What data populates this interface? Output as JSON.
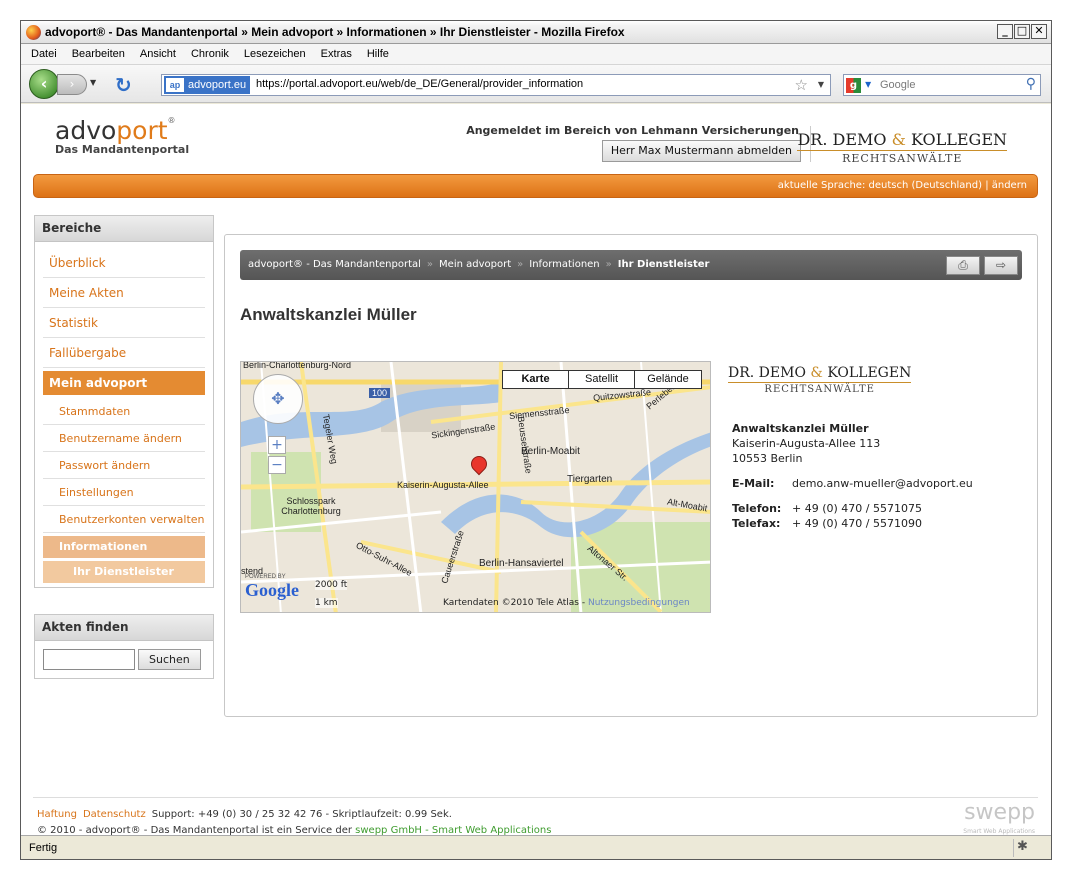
{
  "browser": {
    "title": "advoport® - Das Mandantenportal » Mein advoport » Informationen » Ihr Dienstleister - Mozilla Firefox",
    "menu": [
      "Datei",
      "Bearbeiten",
      "Ansicht",
      "Chronik",
      "Lesezeichen",
      "Extras",
      "Hilfe"
    ],
    "identity": "advoport.eu",
    "identity_badge": "ap",
    "url": "https://portal.advoport.eu/web/de_DE/General/provider_information",
    "search_placeholder": "Google",
    "status": "Fertig"
  },
  "header": {
    "logo_word_a": "advo",
    "logo_word_b": "port",
    "logo_sub": "Das Mandantenportal",
    "login_info": "Angemeldet im Bereich von Lehmann Versicherungen",
    "logout_label": "Herr Max Mustermann abmelden",
    "firm_name_a": "DR. DEMO",
    "firm_amp": "&",
    "firm_name_b": "KOLLEGEN",
    "firm_sub": "RECHTSANWÄLTE",
    "language": "aktuelle Sprache: deutsch (Deutschland) | ändern"
  },
  "sidebar": {
    "heading": "Bereiche",
    "items": [
      "Überblick",
      "Meine Akten",
      "Statistik",
      "Fallübergabe"
    ],
    "active": "Mein advoport",
    "sub_items": [
      "Stammdaten",
      "Benutzername ändern",
      "Passwort ändern",
      "Einstellungen",
      "Benutzerkonten verwalten"
    ],
    "info_item": "Informationen",
    "current_item": "Ihr Dienstleister",
    "search_heading": "Akten finden",
    "search_button": "Suchen"
  },
  "breadcrumb": {
    "items": [
      "advoport® - Das Mandantenportal",
      "Mein advoport",
      "Informationen"
    ],
    "current": "Ihr Dienstleister"
  },
  "main": {
    "title": "Anwaltskanzlei Müller"
  },
  "map": {
    "types": [
      "Karte",
      "Satellit",
      "Gelände"
    ],
    "selected_type": "Karte",
    "labels": [
      "Berlin-Charlottenburg-Nord",
      "Sickingenstraße",
      "Siemensstraße",
      "Quitzowstraße",
      "Perleberg",
      "Berlin-Moabit",
      "Kaiserin-Augusta-Allee",
      "Beusselstraße",
      "Tiergarten",
      "Alt-Moabit",
      "Schlosspark Charlottenburg",
      "Tegeler Weg",
      "Otto-Suhr-Allee",
      "Caueerstraße",
      "Berlin-Hansaviertel",
      "Altonaer Str.",
      "stend"
    ],
    "scale_ft": "2000 ft",
    "scale_km": "1 km",
    "attribution": "Kartendaten ©2010 Tele Atlas -",
    "attribution_link": "Nutzungsbedingungen",
    "powered_by": "POWERED BY",
    "google": "Google",
    "road_badge": "100"
  },
  "contact": {
    "name": "Anwaltskanzlei Müller",
    "street": "Kaiserin-Augusta-Allee 113",
    "city": "10553 Berlin",
    "email_label": "E-Mail:",
    "email": "demo.anw-mueller@advoport.eu",
    "phone_label": "Telefon:",
    "phone": "+ 49 (0) 470 / 5571075",
    "fax_label": "Telefax:",
    "fax": "+ 49 (0) 470 / 5571090"
  },
  "footer": {
    "links": [
      "Haftung",
      "Datenschutz"
    ],
    "support": "Support: +49 (0) 30 / 25 32 42 76 - Skriptlaufzeit: 0.99 Sek.",
    "copyright": "© 2010 - advoport® - Das Mandantenportal ist ein Service der",
    "provider": "swepp GmbH - Smart Web Applications",
    "brand": "swepp",
    "brand_sub": "Smart Web Applications"
  }
}
